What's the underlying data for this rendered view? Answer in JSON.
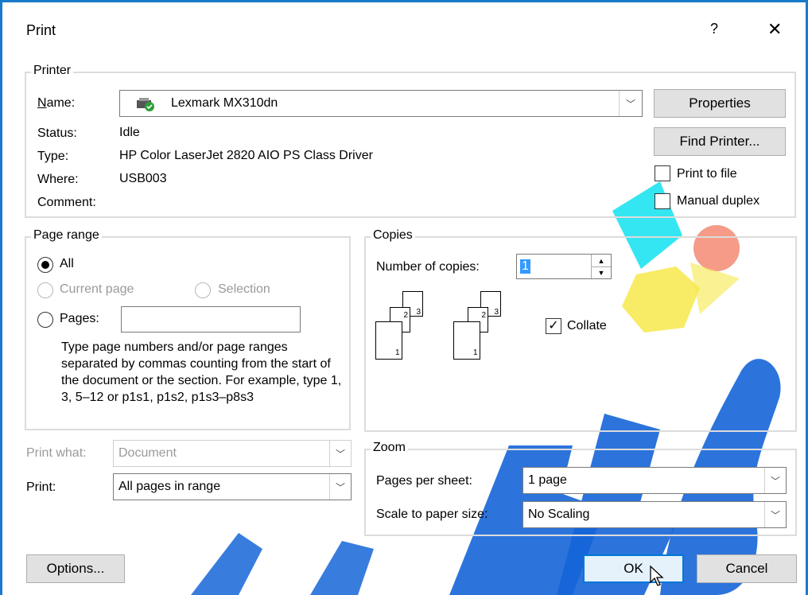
{
  "dialog": {
    "title": "Print",
    "help_label": "?",
    "close_label": "✕"
  },
  "printer": {
    "group_label": "Printer",
    "name_label": "Name:",
    "name_value": "Lexmark MX310dn",
    "status_label": "Status:",
    "status_value": "Idle",
    "type_label": "Type:",
    "type_value": "HP Color LaserJet 2820 AIO PS Class Driver",
    "where_label": "Where:",
    "where_value": "USB003",
    "comment_label": "Comment:",
    "comment_value": "",
    "properties_label": "Properties",
    "find_printer_label": "Find Printer...",
    "print_to_file_label": "Print to file",
    "print_to_file_checked": false,
    "manual_duplex_label": "Manual duplex",
    "manual_duplex_checked": false
  },
  "page_range": {
    "group_label": "Page range",
    "all_label": "All",
    "current_page_label": "Current page",
    "selection_label": "Selection",
    "pages_label": "Pages:",
    "pages_value": "",
    "selected": "All",
    "help_text": "Type page numbers and/or page ranges separated by commas counting from the start of the document or the section. For example, type 1, 3, 5–12 or p1s1, p1s2, p1s3–p8s3"
  },
  "copies": {
    "group_label": "Copies",
    "number_label": "Number of copies:",
    "number_value": "1",
    "collate_label": "Collate",
    "collate_checked": true,
    "page_numbers": [
      "1",
      "2",
      "3"
    ]
  },
  "print_what": {
    "label": "Print what:",
    "value": "Document"
  },
  "print": {
    "label": "Print:",
    "value": "All pages in range"
  },
  "zoom": {
    "group_label": "Zoom",
    "pages_per_sheet_label": "Pages per sheet:",
    "pages_per_sheet_value": "1 page",
    "scale_label": "Scale to paper size:",
    "scale_value": "No Scaling"
  },
  "buttons": {
    "options_label": "Options...",
    "ok_label": "OK",
    "cancel_label": "Cancel"
  },
  "colors": {
    "accent": "#0078d7",
    "frame": "#1979ca",
    "watermark_blue": "#1565d8",
    "watermark_cyan": "#1ee3f0",
    "watermark_yellow": "#f7e84a",
    "watermark_salmon": "#f4907a"
  }
}
